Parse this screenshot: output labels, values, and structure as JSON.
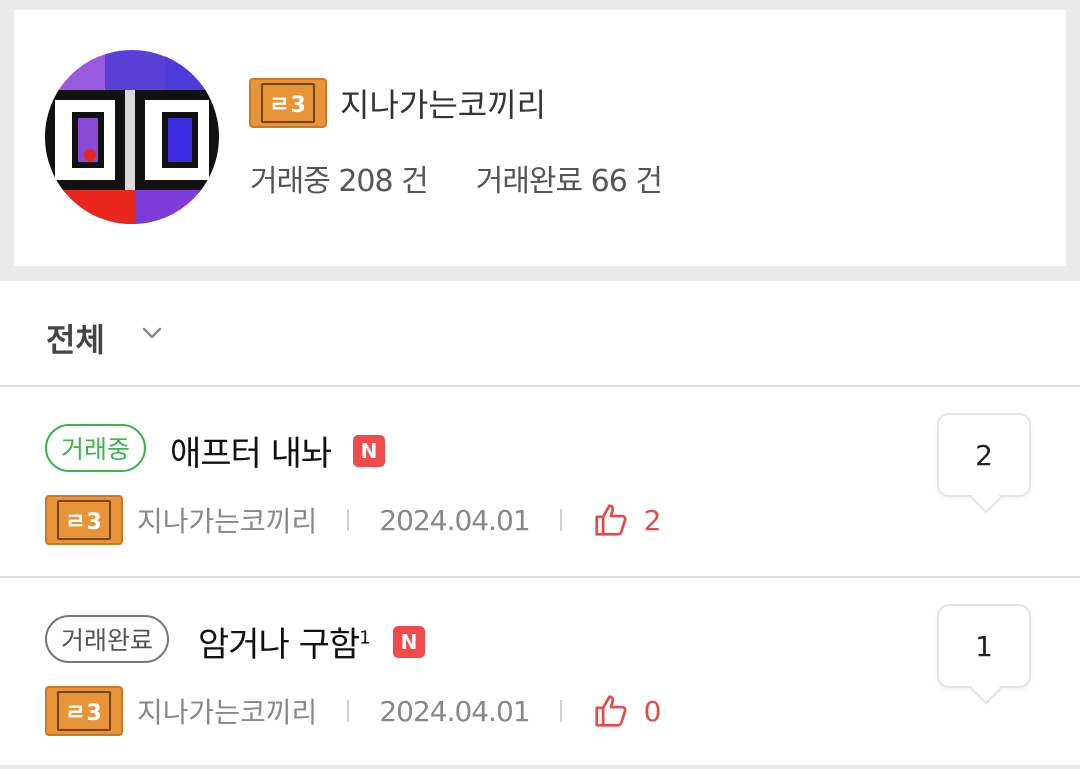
{
  "profile": {
    "level_badge": "ㄹ3",
    "nickname": "지나가는코끼리",
    "stats": {
      "trading": "거래중 208 건",
      "completed": "거래완료 66 건"
    }
  },
  "filter": {
    "label": "전체"
  },
  "posts": [
    {
      "status": "거래중",
      "title": "애프터 내놔",
      "title_sup": "",
      "new_badge": "N",
      "author_badge": "ㄹ3",
      "author": "지나가는코끼리",
      "date": "2024.04.01",
      "likes": "2",
      "comments": "2"
    },
    {
      "status": "거래완료",
      "title": "암거나 구함",
      "title_sup": "1",
      "new_badge": "N",
      "author_badge": "ㄹ3",
      "author": "지나가는코끼리",
      "date": "2024.04.01",
      "likes": "0",
      "comments": "1"
    }
  ],
  "colors": {
    "badge_orange": "#e8953a",
    "status_active": "#3bb54a",
    "like_red": "#e44a4a",
    "new_red": "#ef4b4b"
  }
}
